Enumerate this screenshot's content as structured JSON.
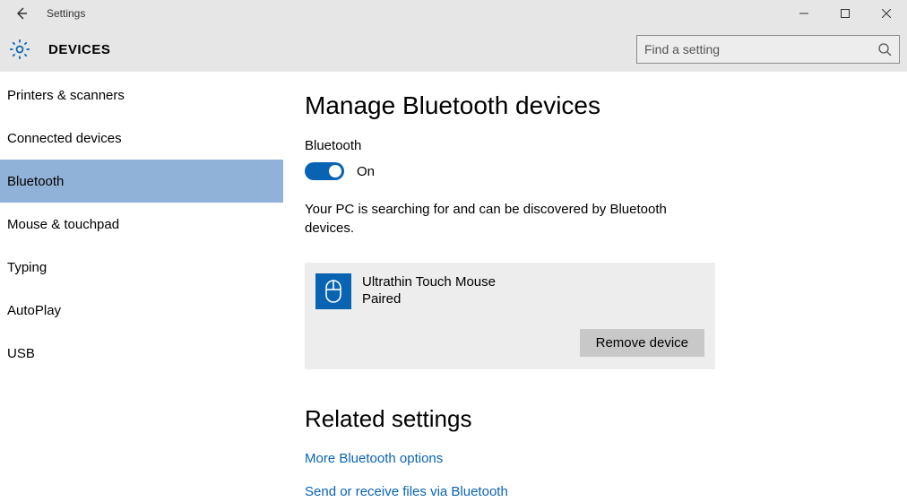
{
  "window": {
    "title": "Settings"
  },
  "header": {
    "title": "DEVICES",
    "search_placeholder": "Find a setting"
  },
  "sidebar": {
    "items": [
      {
        "label": "Printers & scanners",
        "selected": false
      },
      {
        "label": "Connected devices",
        "selected": false
      },
      {
        "label": "Bluetooth",
        "selected": true
      },
      {
        "label": "Mouse & touchpad",
        "selected": false
      },
      {
        "label": "Typing",
        "selected": false
      },
      {
        "label": "AutoPlay",
        "selected": false
      },
      {
        "label": "USB",
        "selected": false
      }
    ]
  },
  "main": {
    "heading": "Manage Bluetooth devices",
    "toggle_label": "Bluetooth",
    "toggle_state_text": "On",
    "toggle_on": true,
    "status_text": "Your PC is searching for and can be discovered by Bluetooth devices.",
    "device": {
      "name": "Ultrathin Touch Mouse",
      "status": "Paired",
      "remove_label": "Remove device"
    },
    "related_heading": "Related settings",
    "links": [
      "More Bluetooth options",
      "Send or receive files via Bluetooth"
    ]
  }
}
